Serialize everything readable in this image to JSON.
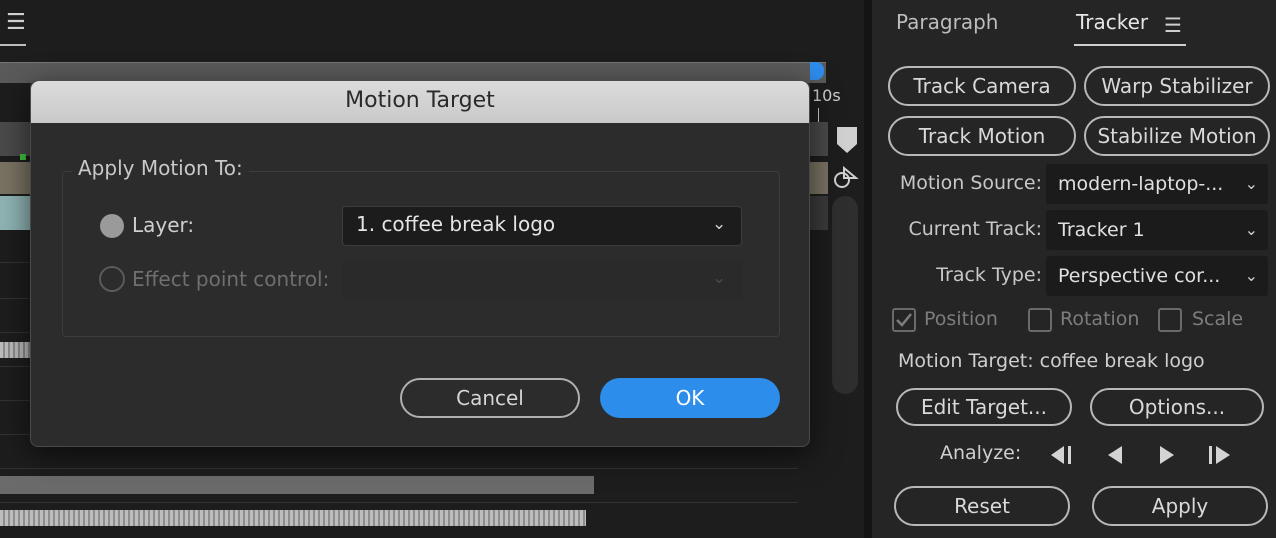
{
  "timeline": {
    "time_label": "10s"
  },
  "tracker_panel": {
    "tabs": [
      "Paragraph",
      "Tracker"
    ],
    "active_tab": "Tracker",
    "buttons": {
      "track_camera": "Track Camera",
      "warp_stabilizer": "Warp Stabilizer",
      "track_motion": "Track Motion",
      "stabilize_motion": "Stabilize Motion",
      "edit_target": "Edit Target...",
      "options": "Options...",
      "reset": "Reset",
      "apply": "Apply"
    },
    "motion_source": {
      "label": "Motion Source:",
      "value": "modern-laptop-..."
    },
    "current_track": {
      "label": "Current Track:",
      "value": "Tracker 1"
    },
    "track_type": {
      "label": "Track Type:",
      "value": "Perspective cor..."
    },
    "checkboxes": [
      {
        "label": "Position",
        "checked": true
      },
      {
        "label": "Rotation",
        "checked": false
      },
      {
        "label": "Scale",
        "checked": false
      }
    ],
    "motion_target_text": "Motion Target: coffee break logo",
    "analyze_label": "Analyze:"
  },
  "dialog": {
    "title": "Motion Target",
    "group_label": "Apply Motion To:",
    "layer_option": {
      "label": "Layer:",
      "selected": true,
      "value": "1. coffee break logo"
    },
    "effect_option": {
      "label": "Effect point control:",
      "selected": false,
      "enabled": false
    },
    "cancel_label": "Cancel",
    "ok_label": "OK"
  },
  "colors": {
    "accent": "#2c8deb",
    "panel_bg": "#252525",
    "dialog_bg": "#2c2c2c"
  }
}
